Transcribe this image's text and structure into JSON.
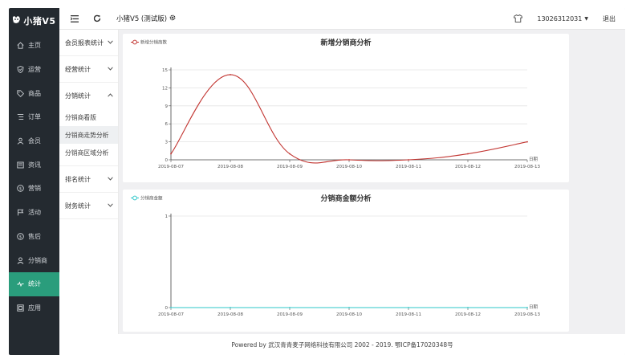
{
  "app": {
    "logo_text": "小猪V5",
    "shop_name": "小猪V5 (测试版)"
  },
  "sidebar": {
    "items": [
      {
        "label": "主页",
        "icon": "home-icon"
      },
      {
        "label": "运营",
        "icon": "shield-icon"
      },
      {
        "label": "商品",
        "icon": "tag-icon"
      },
      {
        "label": "订单",
        "icon": "list-icon"
      },
      {
        "label": "会员",
        "icon": "users-icon"
      },
      {
        "label": "资讯",
        "icon": "news-icon"
      },
      {
        "label": "营销",
        "icon": "dollar-icon"
      },
      {
        "label": "活动",
        "icon": "flag-icon"
      },
      {
        "label": "售后",
        "icon": "dollar-circle-icon"
      },
      {
        "label": "分销商",
        "icon": "user-icon"
      },
      {
        "label": "统计",
        "icon": "pulse-icon",
        "active": true
      },
      {
        "label": "应用",
        "icon": "app-icon"
      }
    ]
  },
  "header": {
    "user_phone": "13026312031",
    "logout_label": "退出"
  },
  "submenu": {
    "groups": [
      {
        "title": "会员报表统计",
        "expanded": false,
        "children": []
      },
      {
        "title": "经营统计",
        "expanded": false,
        "children": []
      },
      {
        "title": "分销统计",
        "expanded": true,
        "children": [
          "分销商看版",
          "分销商走势分析",
          "分销商区域分析"
        ],
        "active_child": 1
      },
      {
        "title": "排名统计",
        "expanded": false,
        "children": []
      },
      {
        "title": "财务统计",
        "expanded": false,
        "children": []
      }
    ]
  },
  "chart_data": [
    {
      "type": "line",
      "title": "新增分销商分析",
      "series": [
        {
          "name": "新增分销商数",
          "color": "#c23531",
          "values": [
            1,
            14.2,
            1,
            0,
            0,
            1,
            3
          ]
        }
      ],
      "categories": [
        "2019-08-07",
        "2019-08-08",
        "2019-08-09",
        "2019-08-10",
        "2019-08-11",
        "2019-08-12",
        "2019-08-13"
      ],
      "xlabel": "日期",
      "ylabel": "",
      "yticks": [
        0,
        3,
        6,
        9,
        12,
        15
      ],
      "ylim": [
        0,
        15
      ],
      "legend": "top-left",
      "smooth": true
    },
    {
      "type": "line",
      "title": "分销商金额分析",
      "series": [
        {
          "name": "分销商金额",
          "color": "#2ec7c9",
          "values": [
            0,
            0,
            0,
            0,
            0,
            0,
            0
          ]
        }
      ],
      "categories": [
        "2019-08-07",
        "2019-08-08",
        "2019-08-09",
        "2019-08-10",
        "2019-08-11",
        "2019-08-12",
        "2019-08-13"
      ],
      "xlabel": "日期",
      "ylabel": "",
      "yticks": [
        0,
        1
      ],
      "ylim": [
        0,
        1
      ],
      "legend": "top-left",
      "smooth": true
    }
  ],
  "footer": {
    "text": "Powered by 武汉青青麦子网络科技有限公司 2002 - 2019. 鄂ICP备17020348号"
  }
}
